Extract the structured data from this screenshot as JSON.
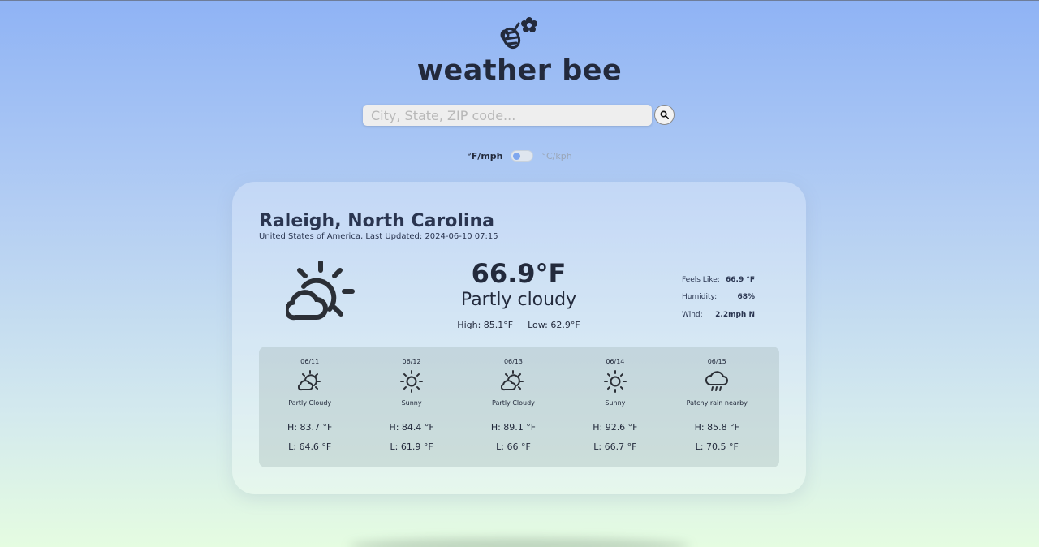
{
  "app": {
    "title": "weather bee",
    "logo_icon": "bee-flower-icon"
  },
  "search": {
    "placeholder": "City, State, ZIP code...",
    "value": "",
    "button_icon": "search-icon"
  },
  "units": {
    "imperial_label": "°F/mph",
    "metric_label": "°C/kph",
    "selected": "imperial"
  },
  "current": {
    "city": "Raleigh, North Carolina",
    "subline": "United States of America, Last Updated: 2024-06-10 07:15",
    "icon": "partly-cloudy-icon",
    "temp": "66.9°F",
    "condition": "Partly cloudy",
    "high": "High: 85.1°F",
    "low": "Low: 62.9°F",
    "details": [
      {
        "label": "Feels Like:",
        "value": "66.9 °F"
      },
      {
        "label": "Humidity:",
        "value": "68%"
      },
      {
        "label": "Wind:",
        "value": "2.2mph N"
      }
    ]
  },
  "forecast": [
    {
      "date": "06/11",
      "icon": "partly-cloudy-icon",
      "condition": "Partly Cloudy",
      "high": "H: 83.7 °F",
      "low": "L: 64.6 °F"
    },
    {
      "date": "06/12",
      "icon": "sunny-icon",
      "condition": "Sunny",
      "high": "H: 84.4 °F",
      "low": "L: 61.9 °F"
    },
    {
      "date": "06/13",
      "icon": "partly-cloudy-icon",
      "condition": "Partly Cloudy",
      "high": "H: 89.1 °F",
      "low": "L: 66 °F"
    },
    {
      "date": "06/14",
      "icon": "sunny-icon",
      "condition": "Sunny",
      "high": "H: 92.6 °F",
      "low": "L: 66.7 °F"
    },
    {
      "date": "06/15",
      "icon": "rain-cloud-icon",
      "condition": "Patchy rain nearby",
      "high": "H: 85.8 °F",
      "low": "L: 70.5 °F"
    }
  ],
  "colors": {
    "text": "#232a3c",
    "toggle_knob": "#7fa7ee",
    "gradient_top": "#8fb3f5",
    "gradient_bottom": "#e5fce1"
  }
}
